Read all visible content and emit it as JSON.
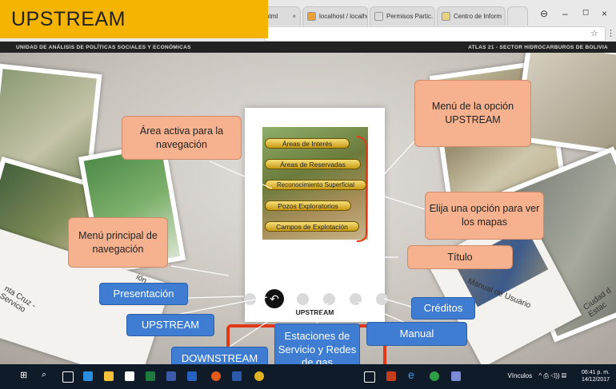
{
  "overlay_title": "UPSTREAM",
  "browser": {
    "tabs": [
      {
        "label": "html",
        "close": "×"
      },
      {
        "label": "localhost / localho",
        "close": "×"
      },
      {
        "label": "Permisos Partic. y",
        "close": "×"
      },
      {
        "label": "Centro de Inform",
        "close": "×"
      }
    ],
    "window_controls": {
      "account": "⊖",
      "minimize": "–",
      "maximize": "◻",
      "close": "×"
    },
    "bookmark_star": "☆",
    "menu": "⋮"
  },
  "app_header": {
    "left": "UNIDAD DE ANÁLISIS DE POLÍTICAS SOCIALES Y ECONÓMICAS",
    "right": "ATLAS 21 - SECTOR HIDROCARBUROS DE BOLIVIA"
  },
  "card": {
    "menu_items": [
      "Áreas de Interés",
      "Áreas de Reservadas",
      "Reconocimiento Superficial",
      "Pozos Exploratorios",
      "Campos de Explotación"
    ],
    "title": "UPSTREAM"
  },
  "background_labels": {
    "left_card": "nta Cruz -\nServicio",
    "left_card2": "ión",
    "right_card1": "Manual de Usuario",
    "right_card2": "Ciudad d\nEstac"
  },
  "callouts": {
    "active_area": "Área activa para la navegación",
    "menu_option": "Menú de la opción UPSTREAM",
    "choose_option": "Elija una opción para ver los mapas",
    "title": "Título",
    "main_menu": "Menú principal de navegación"
  },
  "nav_labels": {
    "presentacion": "Presentación",
    "upstream": "UPSTREAM",
    "downstream": "DOWNSTREAM",
    "estaciones": "Estaciones de Servicio y Redes de gas",
    "manual": "Manual",
    "creditos": "Créditos"
  },
  "nav_active_glyph": "↶",
  "taskbar": {
    "links_label": "Vínculos",
    "tray_icons": "^ ⎙ ◁)) ▤",
    "time": "06:41 p. m.",
    "date": "14/12/2017"
  },
  "colors": {
    "callout_fill": "#f6b28f",
    "label_blue": "#3f7dd2",
    "title_banner": "#f5b400",
    "nav_frame": "#e2381a",
    "bracket": "#e2381a"
  }
}
